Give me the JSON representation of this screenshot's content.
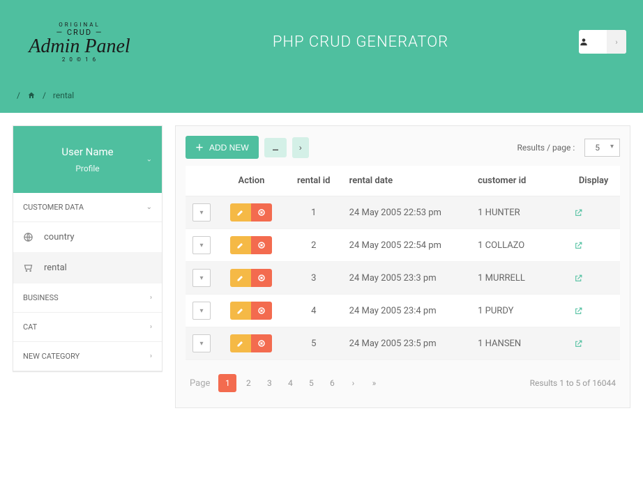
{
  "header": {
    "logo": {
      "line1": "ORIGINAL",
      "line2": "— CRUD —",
      "line3": "Admin Panel",
      "line4": "2 0 © 1 6"
    },
    "title": "PHP CRUD GENERATOR"
  },
  "breadcrumb": {
    "current": "rental"
  },
  "sidebar": {
    "user": {
      "name": "User Name",
      "profile": "Profile"
    },
    "categories": [
      {
        "label": "CUSTOMER DATA",
        "open": true,
        "items": [
          {
            "label": "country",
            "icon": "globe",
            "active": false
          },
          {
            "label": "rental",
            "icon": "cart",
            "active": true
          }
        ]
      },
      {
        "label": "BUSINESS",
        "open": false,
        "items": []
      },
      {
        "label": "CAT",
        "open": false,
        "items": []
      },
      {
        "label": "NEW CATEGORY",
        "open": false,
        "items": []
      }
    ]
  },
  "toolbar": {
    "add_label": "ADD NEW",
    "results_label": "Results / page :",
    "results_value": "5"
  },
  "table": {
    "headers": {
      "action": "Action",
      "rental_id": "rental id",
      "rental_date": "rental date",
      "customer_id": "customer id",
      "display": "Display"
    },
    "rows": [
      {
        "id": "1",
        "date": "24 May 2005 22:53 pm",
        "customer": "1 HUNTER"
      },
      {
        "id": "2",
        "date": "24 May 2005 22:54 pm",
        "customer": "1 COLLAZO"
      },
      {
        "id": "3",
        "date": "24 May 2005 23:3 pm",
        "customer": "1 MURRELL"
      },
      {
        "id": "4",
        "date": "24 May 2005 23:4 pm",
        "customer": "1 PURDY"
      },
      {
        "id": "5",
        "date": "24 May 2005 23:5 pm",
        "customer": "1 HANSEN"
      }
    ]
  },
  "pagination": {
    "label": "Page",
    "pages": [
      "1",
      "2",
      "3",
      "4",
      "5",
      "6"
    ],
    "active": "1",
    "summary": "Results 1 to 5 of 16044"
  }
}
